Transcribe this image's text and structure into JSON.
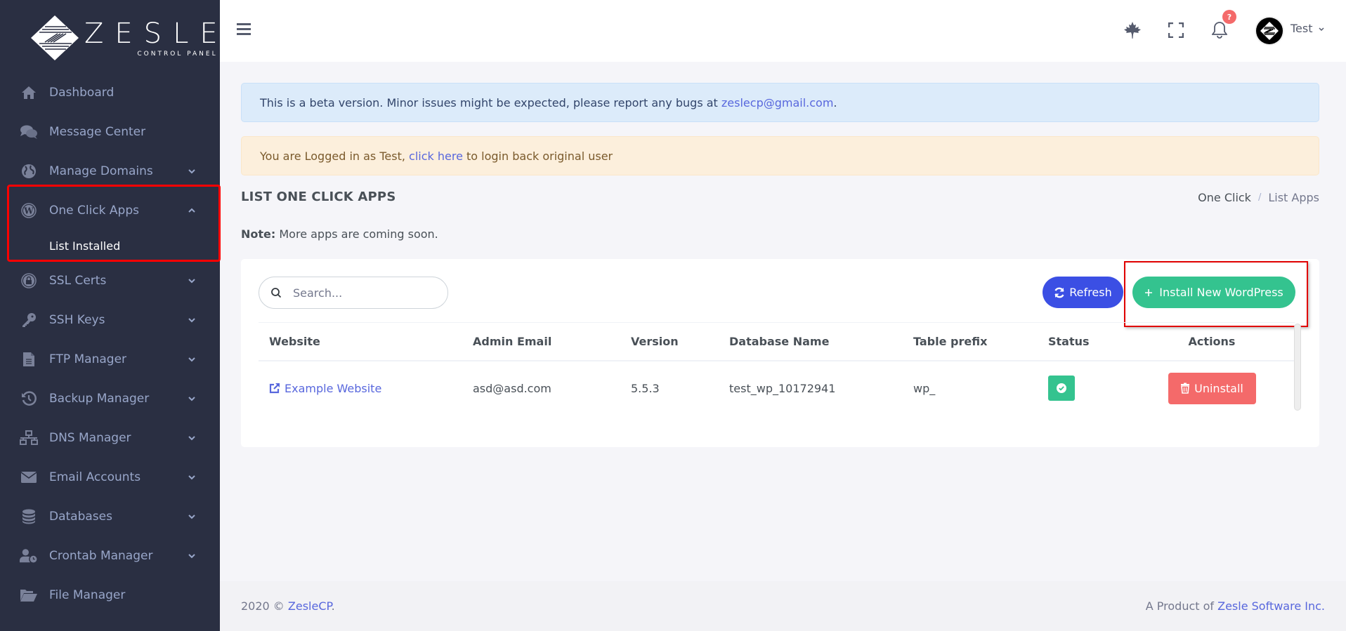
{
  "brand": {
    "name": "ZESLE",
    "subtitle": "CONTROL PANEL"
  },
  "sidebar": {
    "items": [
      {
        "label": "Dashboard",
        "icon": "home-icon",
        "has_chevron": false
      },
      {
        "label": "Message Center",
        "icon": "comments-icon",
        "has_chevron": false
      },
      {
        "label": "Manage Domains",
        "icon": "globe-icon",
        "has_chevron": true
      },
      {
        "label": "One Click Apps",
        "icon": "wordpress-icon",
        "has_chevron": true,
        "expanded": true,
        "children": [
          {
            "label": "List Installed",
            "active": true
          }
        ]
      },
      {
        "label": "SSL Certs",
        "icon": "lock-icon",
        "has_chevron": true
      },
      {
        "label": "SSH Keys",
        "icon": "key-icon",
        "has_chevron": true
      },
      {
        "label": "FTP Manager",
        "icon": "file-icon",
        "has_chevron": true
      },
      {
        "label": "Backup Manager",
        "icon": "history-icon",
        "has_chevron": true
      },
      {
        "label": "DNS Manager",
        "icon": "network-icon",
        "has_chevron": true
      },
      {
        "label": "Email Accounts",
        "icon": "envelope-icon",
        "has_chevron": true
      },
      {
        "label": "Databases",
        "icon": "database-icon",
        "has_chevron": true
      },
      {
        "label": "Crontab Manager",
        "icon": "user-clock-icon",
        "has_chevron": true
      },
      {
        "label": "File Manager",
        "icon": "folder-open-icon",
        "has_chevron": false
      }
    ]
  },
  "header": {
    "notification_badge": "?",
    "user_name": "Test"
  },
  "alerts": {
    "beta": {
      "text": "This is a beta version. Minor issues might be expected, please report any bugs at ",
      "link": "zeslecp@gmail.com",
      "suffix": "."
    },
    "login": {
      "text": "You are Logged in as Test, ",
      "link": "click here",
      "suffix": " to login back original user"
    }
  },
  "page": {
    "title": "LIST ONE CLICK APPS",
    "breadcrumb": [
      "One Click",
      "List Apps"
    ],
    "note_label": "Note:",
    "note_text": " More apps are coming soon."
  },
  "toolbar": {
    "search_placeholder": "Search...",
    "search_value": "",
    "refresh_label": "Refresh",
    "install_label": "Install New WordPress"
  },
  "table": {
    "columns": [
      "Website",
      "Admin Email",
      "Version",
      "Database Name",
      "Table prefix",
      "Status",
      "Actions"
    ],
    "rows": [
      {
        "website": "Example Website",
        "admin_email": "asd@asd.com",
        "version": "5.5.3",
        "database_name": "test_wp_10172941",
        "table_prefix": "wp_",
        "status": "active",
        "action_label": "Uninstall"
      }
    ]
  },
  "footer": {
    "left_prefix": "2020 © ",
    "left_link": "ZesleCP",
    "left_suffix": ".",
    "right_prefix": "A Product of ",
    "right_link": "Zesle Software Inc."
  },
  "colors": {
    "sidebar_bg": "#2a2f42",
    "primary": "#3b4fe4",
    "success": "#34c38f",
    "danger": "#f46a6a",
    "link": "#5867dd",
    "highlight": "#ff0000"
  }
}
